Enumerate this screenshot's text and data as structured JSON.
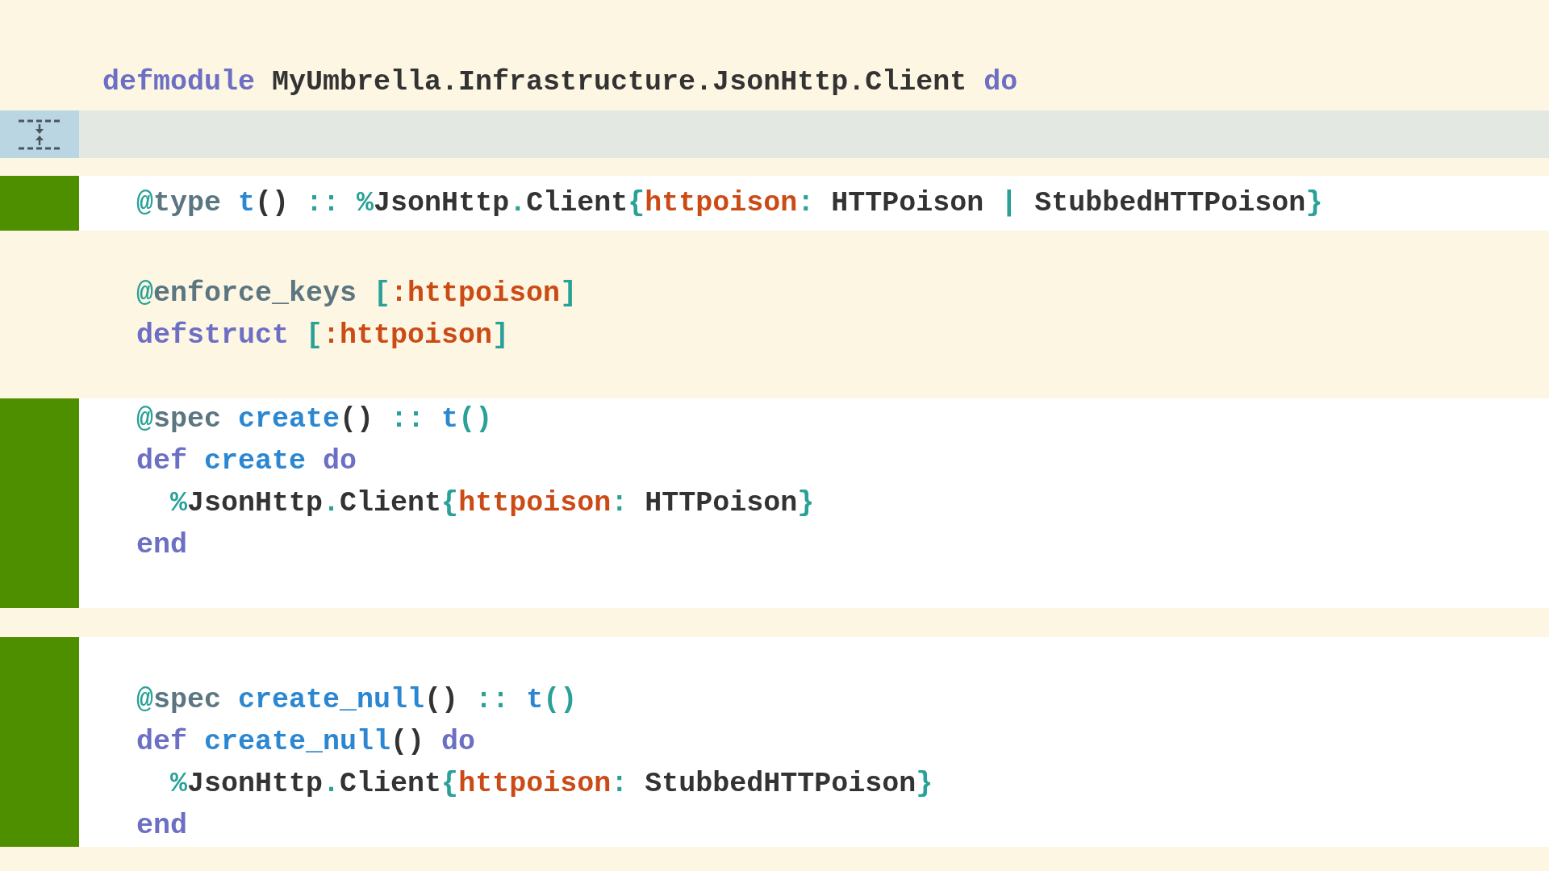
{
  "diff": {
    "hunks": [
      {
        "kind": "context",
        "lines": [
          {
            "kind": "code",
            "tokens": [
              {
                "t": "defmodule",
                "kind": "kw"
              },
              {
                "t": " MyUmbrella.Infrastructure.JsonHttp.Client ",
                "kind": "plain"
              },
              {
                "t": "do",
                "kind": "kw"
              }
            ]
          }
        ]
      },
      {
        "kind": "expander"
      },
      {
        "kind": "gap"
      },
      {
        "kind": "added",
        "lines": [
          {
            "kind": "code",
            "tokens": [
              {
                "t": "  @",
                "kind": "at"
              },
              {
                "t": "type ",
                "kind": "attr"
              },
              {
                "t": "t",
                "kind": "fn"
              },
              {
                "t": "()",
                "kind": "plain"
              },
              {
                "t": " :: %",
                "kind": "punct"
              },
              {
                "t": "JsonHttp",
                "kind": "plain"
              },
              {
                "t": ".",
                "kind": "punct"
              },
              {
                "t": "Client",
                "kind": "plain"
              },
              {
                "t": "{",
                "kind": "punct"
              },
              {
                "t": "httpoison",
                "kind": "atom"
              },
              {
                "t": ":",
                "kind": "punct"
              },
              {
                "t": " HTTPoison ",
                "kind": "plain"
              },
              {
                "t": "|",
                "kind": "punct"
              },
              {
                "t": " StubbedHTTPoison",
                "kind": "plain"
              },
              {
                "t": "}",
                "kind": "punct"
              }
            ]
          }
        ]
      },
      {
        "kind": "context",
        "lines": [
          {
            "kind": "blank"
          },
          {
            "kind": "code",
            "tokens": [
              {
                "t": "  @",
                "kind": "at"
              },
              {
                "t": "enforce_keys",
                "kind": "attr"
              },
              {
                "t": " [",
                "kind": "punct"
              },
              {
                "t": ":httpoison",
                "kind": "atom"
              },
              {
                "t": "]",
                "kind": "punct"
              }
            ]
          },
          {
            "kind": "code",
            "tokens": [
              {
                "t": "  defstruct",
                "kind": "kw"
              },
              {
                "t": " [",
                "kind": "punct"
              },
              {
                "t": ":httpoison",
                "kind": "atom"
              },
              {
                "t": "]",
                "kind": "punct"
              }
            ]
          },
          {
            "kind": "blank"
          }
        ]
      },
      {
        "kind": "added",
        "lines": [
          {
            "kind": "code",
            "tokens": [
              {
                "t": "  @",
                "kind": "at"
              },
              {
                "t": "spec ",
                "kind": "attr"
              },
              {
                "t": "create",
                "kind": "fn"
              },
              {
                "t": "()",
                "kind": "plain"
              },
              {
                "t": " :: ",
                "kind": "punct"
              },
              {
                "t": "t",
                "kind": "fn"
              },
              {
                "t": "()",
                "kind": "punct"
              }
            ]
          },
          {
            "kind": "code",
            "tokens": [
              {
                "t": "  def ",
                "kind": "kw"
              },
              {
                "t": "create ",
                "kind": "fn"
              },
              {
                "t": "do",
                "kind": "kw"
              }
            ]
          },
          {
            "kind": "code",
            "tokens": [
              {
                "t": "    %",
                "kind": "punct"
              },
              {
                "t": "JsonHttp",
                "kind": "plain"
              },
              {
                "t": ".",
                "kind": "punct"
              },
              {
                "t": "Client",
                "kind": "plain"
              },
              {
                "t": "{",
                "kind": "punct"
              },
              {
                "t": "httpoison",
                "kind": "atom"
              },
              {
                "t": ":",
                "kind": "punct"
              },
              {
                "t": " HTTPoison",
                "kind": "plain"
              },
              {
                "t": "}",
                "kind": "punct"
              }
            ]
          },
          {
            "kind": "code",
            "tokens": [
              {
                "t": "  end",
                "kind": "kw"
              }
            ]
          },
          {
            "kind": "blank"
          }
        ]
      },
      {
        "kind": "gap"
      },
      {
        "kind": "added",
        "lines": [
          {
            "kind": "blank"
          },
          {
            "kind": "code",
            "tokens": [
              {
                "t": "  @",
                "kind": "at"
              },
              {
                "t": "spec ",
                "kind": "attr"
              },
              {
                "t": "create_null",
                "kind": "fn"
              },
              {
                "t": "()",
                "kind": "plain"
              },
              {
                "t": " :: ",
                "kind": "punct"
              },
              {
                "t": "t",
                "kind": "fn"
              },
              {
                "t": "()",
                "kind": "punct"
              }
            ]
          },
          {
            "kind": "code",
            "tokens": [
              {
                "t": "  def ",
                "kind": "kw"
              },
              {
                "t": "create_null",
                "kind": "fn"
              },
              {
                "t": "() ",
                "kind": "plain"
              },
              {
                "t": "do",
                "kind": "kw"
              }
            ]
          },
          {
            "kind": "code",
            "tokens": [
              {
                "t": "    %",
                "kind": "punct"
              },
              {
                "t": "JsonHttp",
                "kind": "plain"
              },
              {
                "t": ".",
                "kind": "punct"
              },
              {
                "t": "Client",
                "kind": "plain"
              },
              {
                "t": "{",
                "kind": "punct"
              },
              {
                "t": "httpoison",
                "kind": "atom"
              },
              {
                "t": ":",
                "kind": "punct"
              },
              {
                "t": " StubbedHTTPoison",
                "kind": "plain"
              },
              {
                "t": "}",
                "kind": "punct"
              }
            ]
          },
          {
            "kind": "code",
            "tokens": [
              {
                "t": "  end",
                "kind": "kw"
              }
            ]
          }
        ]
      }
    ]
  }
}
